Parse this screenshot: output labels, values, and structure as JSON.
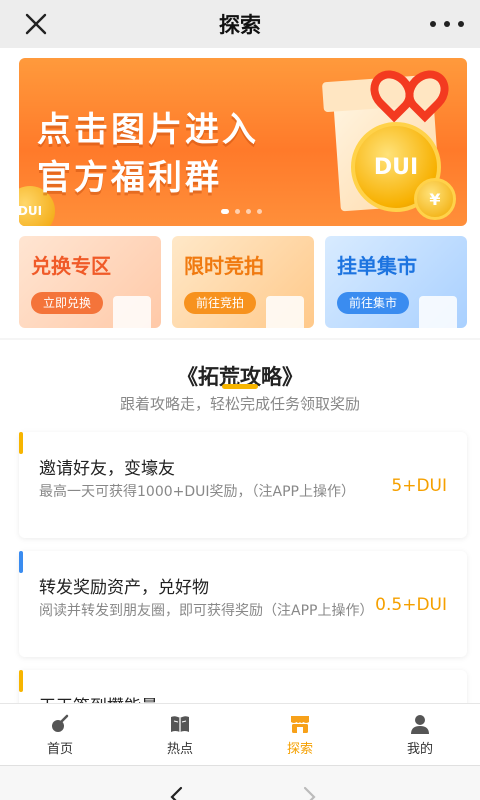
{
  "titlebar": {
    "title": "探索"
  },
  "banner": {
    "line1": "点击图片进入",
    "line2": "官方福利群",
    "coin_text": "DUI",
    "coin2_text": "¥",
    "coin_left_text": "DUI"
  },
  "quick": [
    {
      "title": "兑换专区",
      "button": "立即兑换"
    },
    {
      "title": "限时竞拍",
      "button": "前往竞拍"
    },
    {
      "title": "挂单集市",
      "button": "前往集市"
    }
  ],
  "guide": {
    "title": "《拓荒攻略》",
    "subtitle": "跟着攻略走，轻松完成任务领取奖励"
  },
  "tasks": [
    {
      "title": "邀请好友，变壕友",
      "desc": "最高一天可获得1000+DUI奖励，（注APP上操作）",
      "reward": "5+DUI"
    },
    {
      "title": "转发奖励资产，兑好物",
      "desc": "阅读并转发到朋友圈，即可获得奖励（注APP上操作）",
      "reward": "0.5+DUI"
    },
    {
      "title": "天天签到攒能量",
      "desc": "",
      "reward": ""
    }
  ],
  "tabbar": [
    {
      "label": "首页"
    },
    {
      "label": "热点"
    },
    {
      "label": "探索"
    },
    {
      "label": "我的"
    }
  ],
  "colors": {
    "accent": "#f5a000",
    "orange": "#ff7a2a",
    "blue": "#3a8cf0"
  }
}
